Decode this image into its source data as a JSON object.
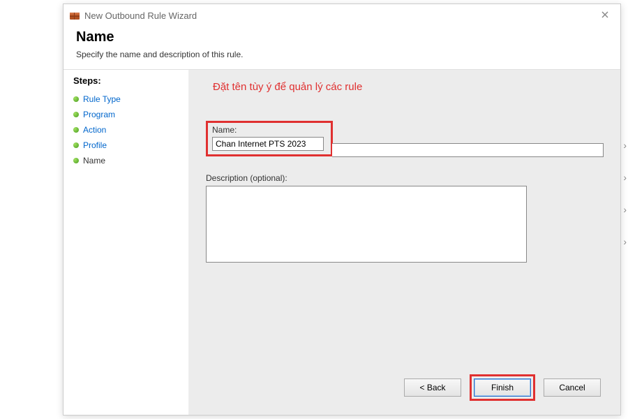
{
  "window": {
    "title": "New Outbound Rule Wizard"
  },
  "header": {
    "title": "Name",
    "subtitle": "Specify the name and description of this rule."
  },
  "sidebar": {
    "title": "Steps:",
    "items": [
      {
        "label": "Rule Type",
        "current": false
      },
      {
        "label": "Program",
        "current": false
      },
      {
        "label": "Action",
        "current": false
      },
      {
        "label": "Profile",
        "current": false
      },
      {
        "label": "Name",
        "current": true
      }
    ]
  },
  "annotation": "Đặt tên tùy ý để quản lý các rule",
  "form": {
    "name_label": "Name:",
    "name_value": "Chan Internet PTS 2023",
    "desc_label": "Description (optional):",
    "desc_value": ""
  },
  "buttons": {
    "back": "< Back",
    "finish": "Finish",
    "cancel": "Cancel"
  }
}
